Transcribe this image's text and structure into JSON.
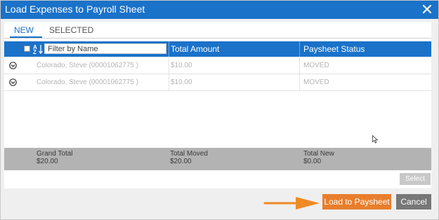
{
  "dialog": {
    "title": "Load Expenses to Payroll Sheet",
    "close_icon": "close-icon"
  },
  "tabs": [
    {
      "label": "NEW",
      "active": true
    },
    {
      "label": "SELECTED",
      "active": false
    }
  ],
  "table": {
    "filter_placeholder": "Filter by Name",
    "columns": [
      "Total Amount",
      "Paysheet Status"
    ],
    "rows": [
      {
        "name": "Colorado, Steve (00001062775 )",
        "amount": "$10.00",
        "status": "MOVED"
      },
      {
        "name": "Colorado, Steve (00001062775 )",
        "amount": "$10.00",
        "status": "MOVED"
      }
    ]
  },
  "totals": {
    "grand_label": "Grand Total",
    "grand_value": "$20.00",
    "moved_label": "Total Moved",
    "moved_value": "$20.00",
    "new_label": "Total New",
    "new_value": "$0.00"
  },
  "buttons": {
    "select": "Select",
    "load": "Load to Paysheet",
    "cancel": "Cancel"
  },
  "colors": {
    "header_blue": "#1a72c9",
    "accent_orange": "#e87e2c",
    "cancel_gray": "#777777"
  }
}
